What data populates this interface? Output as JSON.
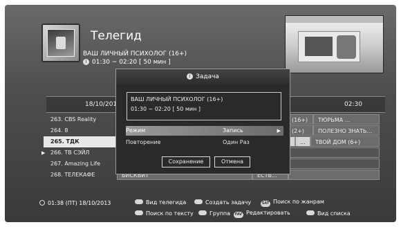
{
  "header": {
    "title": "Телегид",
    "program_title": "ВАШ ЛИЧНЫЙ ПСИХОЛОГ (16+)",
    "program_time": "01:30 ~ 02:20 [ 50 мин ]"
  },
  "timeline": {
    "date": "18/10/2013",
    "time_right": "02:30"
  },
  "channels": [
    {
      "label": "263.  CBS Reality"
    },
    {
      "label": "264.  8"
    },
    {
      "label": "265.  ТДК"
    },
    {
      "label": "266.  ТВ СЭЙЛ"
    },
    {
      "label": "267.  Amazing Life"
    },
    {
      "label": "268.  ТЕЛЕКАФЕ"
    }
  ],
  "programs": {
    "r0_a": "(16+)",
    "r0_b": "ТЮРЬМА ...",
    "r1_a": "(2+)",
    "r1_b": "ПОЛЕЗНО ЗНАТЬ...",
    "r2_a": "...",
    "r2_b": "ТВОЙ ДОМ (6+)",
    "r5_a": "БИСКВИТ",
    "r5_b": "ЕСТЬ..."
  },
  "dialog": {
    "title": "Задача",
    "program_title": "ВАШ ЛИЧНЫЙ ПСИХОЛОГ (16+)",
    "program_time": "01:30 ~ 02:20 [ 50 мин ]",
    "mode_label": "Режим",
    "mode_value": "Запись",
    "repeat_label": "Повторение",
    "repeat_value": "Один Раз",
    "save_label": "Сохранение",
    "cancel_label": "Отмена"
  },
  "footer": {
    "clock": "01:38 (ПТ) 18/10/2013",
    "legend_guide_view": "Вид телегида",
    "legend_create_task": "Создать задачу",
    "sat_key": "SAT",
    "legend_genre_search": "Поиск по жанрам",
    "legend_text_search": "Поиск по тексту",
    "legend_group": "Группа",
    "fav_key": "FAV",
    "legend_edit": "Редактировать",
    "legend_list_view": "Вид списка"
  }
}
